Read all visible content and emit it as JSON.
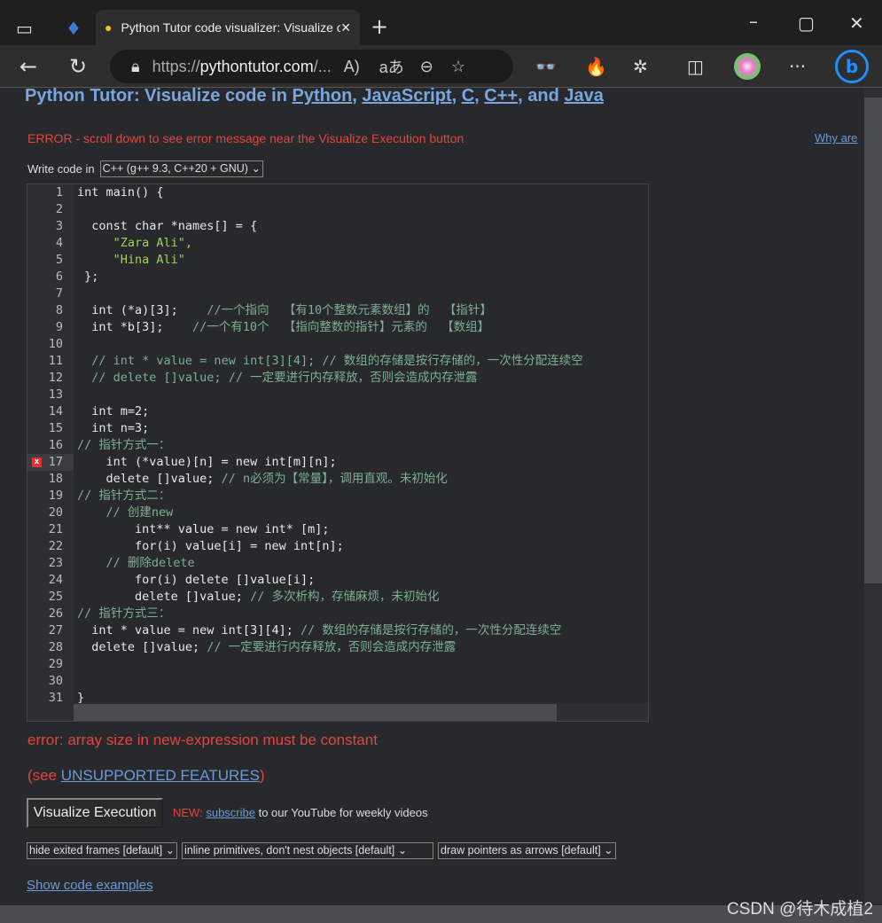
{
  "browser": {
    "tab_title": "Python Tutor code visualizer: Visualize code",
    "url_prefix": "https://",
    "url_host": "pythontutor.com",
    "url_suffix": "/...",
    "icons": [
      "tab-actions-icon",
      "workspaces-icon",
      "python-favicon",
      "close-tab-icon",
      "new-tab-icon",
      "minimize-icon",
      "maximize-icon",
      "close-window-icon",
      "back-icon",
      "refresh-icon",
      "lock-icon",
      "read-aloud-icon",
      "translate-icon",
      "zoom-out-icon",
      "add-favorite-icon",
      "extension-icon",
      "extension-icon-2",
      "extensions-icon",
      "split-screen-icon",
      "profile-avatar",
      "more-icon",
      "bing-copilot-icon"
    ]
  },
  "header": {
    "prefix": "Python Tutor: Visualize code in ",
    "links": [
      "Python",
      "JavaScript",
      "C",
      "C++",
      "Java"
    ],
    "sep": ", ",
    "and": ", and "
  },
  "error_banner": "ERROR - scroll down to see error message near the Visualize Execution button",
  "why_link": "Why are",
  "lang": {
    "label": "Write code in",
    "selected": "C++ (g++ 9.3, C++20 + GNU)"
  },
  "editor": {
    "error_line": 17,
    "lines": [
      "int main() {",
      "",
      "  const char *names[] = {",
      "     \"Zara Ali\",",
      "     \"Hina Ali\"",
      " };",
      "",
      "  int (*a)[3];    //一个指向  【有10个整数元素数组】的  【指针】",
      "  int *b[3];    //一个有10个  【指向整数的指针】元素的  【数组】",
      "",
      "  // int * value = new int[3][4]; // 数组的存储是按行存储的，一次性分配连续空",
      "  // delete []value; // 一定要进行内存释放，否则会造成内存泄露",
      "",
      "  int m=2;",
      "  int n=3;",
      "// 指针方式一：",
      "    int (*value)[n] = new int[m][n];",
      "    delete []value; // n必须为【常量】，调用直观。未初始化",
      "// 指针方式二：",
      "    // 创建new",
      "        int** value = new int* [m];",
      "        for(i) value[i] = new int[n];",
      "    // 删除delete",
      "        for(i) delete []value[i];",
      "        delete []value; // 多次析构，存储麻烦，未初始化",
      "// 指针方式三：",
      "  int * value = new int[3][4]; // 数组的存储是按行存储的，一次性分配连续空",
      "  delete []value; // 一定要进行内存释放，否则会造成内存泄露",
      "",
      "",
      "}"
    ]
  },
  "compile_error": "error: array size in new-expression must be constant",
  "see": {
    "open": "(see ",
    "link": "UNSUPPORTED FEATURES",
    "close": ")"
  },
  "visualize_button": "Visualize Execution",
  "news": {
    "label": "NEW:",
    "link": "subscribe",
    "rest": " to our YouTube for weekly videos"
  },
  "options": [
    "hide exited frames [default]",
    "inline primitives, don't nest objects [default]",
    "draw pointers as arrows [default]"
  ],
  "examples_link": "Show code examples",
  "watermark": "CSDN @待木成植2",
  "colors": {
    "accent": "#7aa6e0",
    "error": "#e0453f",
    "keyword": "#4d8ff0",
    "comment": "#7fae94",
    "string": "#9fd35a"
  }
}
